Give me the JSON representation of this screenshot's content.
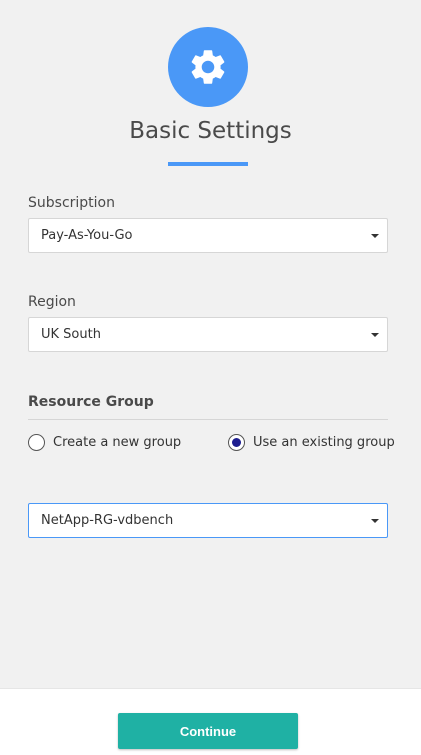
{
  "header": {
    "icon": "gear-icon",
    "title": "Basic Settings"
  },
  "subscription": {
    "label": "Subscription",
    "value": "Pay-As-You-Go"
  },
  "region": {
    "label": "Region",
    "value": "UK South"
  },
  "resource_group": {
    "title": "Resource Group",
    "options": [
      {
        "label": "Create a new group",
        "selected": false
      },
      {
        "label": "Use an existing group",
        "selected": true
      }
    ],
    "value": "NetApp-RG-vdbench"
  },
  "footer": {
    "continue_label": "Continue"
  },
  "colors": {
    "accent": "#4a98f7",
    "button": "#1fb1a4"
  }
}
